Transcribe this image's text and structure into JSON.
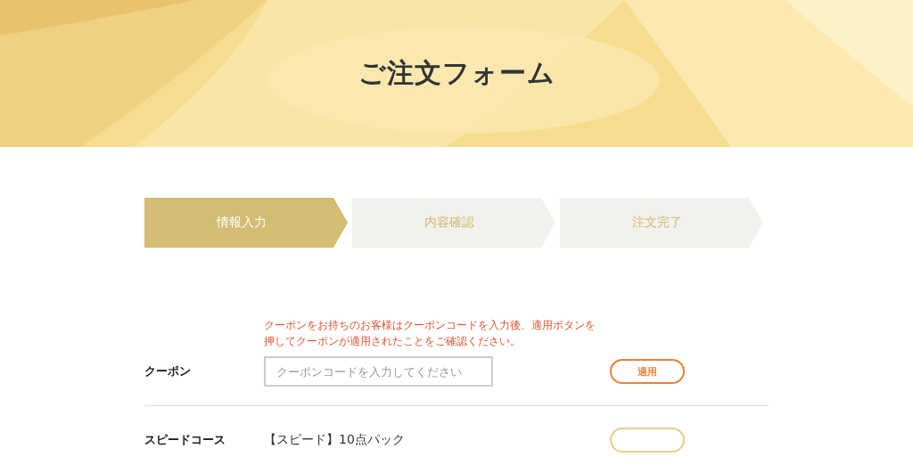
{
  "header": {
    "title": "ご注文フォーム"
  },
  "steps": [
    {
      "label": "情報入力",
      "selected": true
    },
    {
      "label": "内容確認",
      "selected": false
    },
    {
      "label": "注文完了",
      "selected": false
    }
  ],
  "coupon": {
    "label": "クーポン",
    "note": "クーポンをお持ちのお客様はクーポンコードを入力後、適用ボタンを押してクーポンが適用されたことをご確認ください。",
    "placeholder": "クーポンコードを入力してください",
    "button": "適用"
  },
  "speed_course": {
    "label": "スピードコース",
    "value": "【スピード】10点パック"
  }
}
